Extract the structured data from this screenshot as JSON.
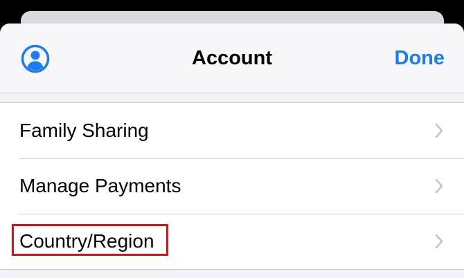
{
  "header": {
    "title": "Account",
    "done_label": "Done"
  },
  "menu": {
    "items": [
      {
        "label": "Family Sharing",
        "highlighted": false
      },
      {
        "label": "Manage Payments",
        "highlighted": false
      },
      {
        "label": "Country/Region",
        "highlighted": true
      }
    ]
  },
  "icons": {
    "profile": "person-circle-icon",
    "chevron": "chevron-right-icon"
  },
  "colors": {
    "accent": "#1a7cf0",
    "highlight": "#e0101a",
    "chevron": "#c4c4c7"
  }
}
